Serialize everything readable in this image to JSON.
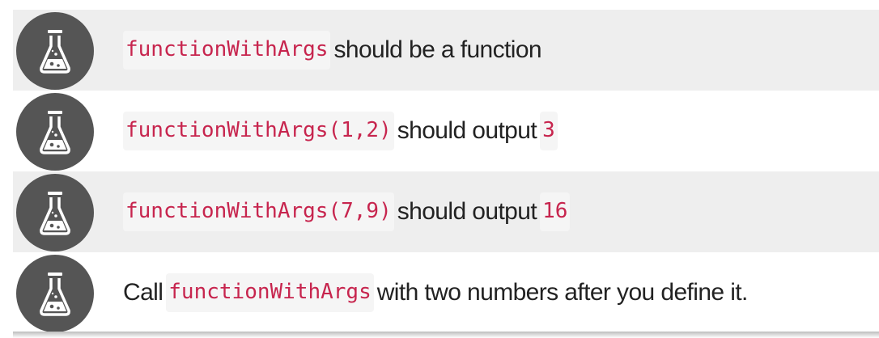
{
  "tests": [
    {
      "icon": "beaker-icon",
      "code": "functionWithArgs",
      "text_after": "should be a function"
    },
    {
      "icon": "beaker-icon",
      "code": "functionWithArgs(1,2)",
      "text_after": "should output",
      "code2": "3"
    },
    {
      "icon": "beaker-icon",
      "code": "functionWithArgs(7,9)",
      "text_after": "should output",
      "code2": "16"
    },
    {
      "icon": "beaker-icon",
      "text_before": "Call",
      "code": "functionWithArgs",
      "text_after": "with two numbers after you define it."
    }
  ],
  "colors": {
    "row_shaded": "#eeeeee",
    "icon_circle": "#555555",
    "code_text": "#c7254e",
    "code_bg": "#f5f5f5",
    "text": "#222222"
  }
}
